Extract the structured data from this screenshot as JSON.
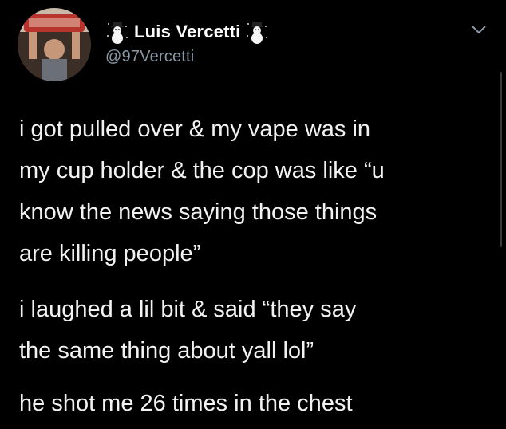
{
  "tweet": {
    "author": {
      "display_name": "Luis Vercetti",
      "handle": "@97Vercetti",
      "name_emoji_left": "snowman-icon",
      "name_emoji_right": "snowman-icon",
      "avatar": "avatar-photo"
    },
    "menu_icon": "chevron-down-icon",
    "paragraphs": [
      "i got pulled over & my vape was in\nmy cup holder & the cop was like “u\nknow the news saying those things\nare killing people”",
      "i laughed a lil bit & said “they say\nthe same thing about yall lol”",
      "he shot me 26 times in the chest"
    ]
  },
  "colors": {
    "background": "#000000",
    "text": "#f2f2f2",
    "handle": "#8b98a5",
    "accent_avatar": "#c0392b"
  }
}
